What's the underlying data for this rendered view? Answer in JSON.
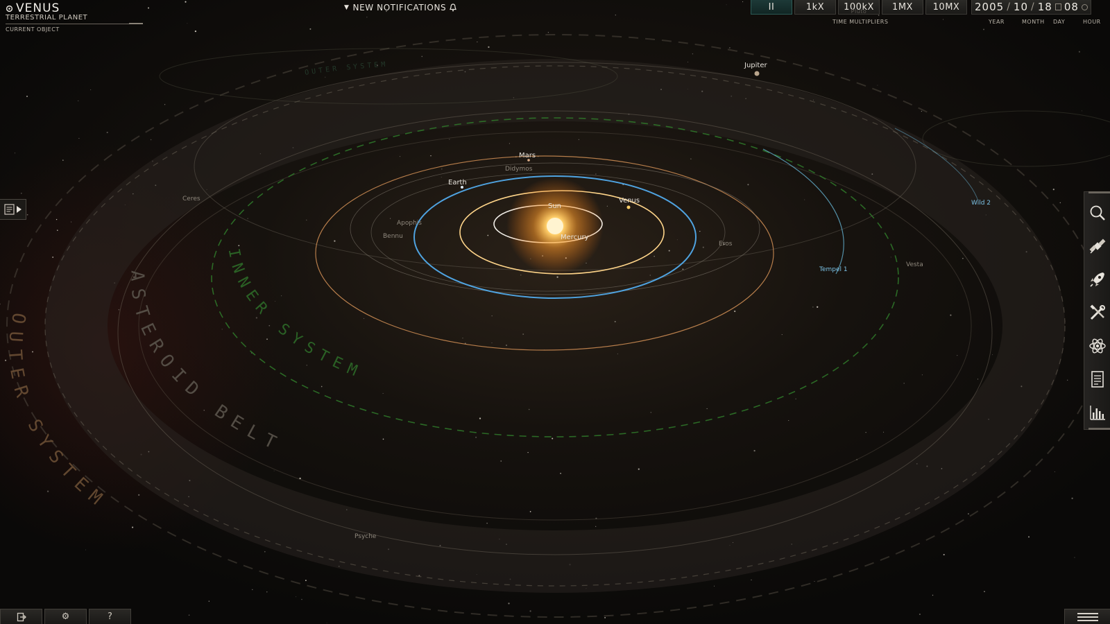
{
  "current_object": {
    "name": "VENUS",
    "type": "TERRESTRIAL PLANET",
    "caption": "CURRENT OBJECT",
    "icon": "planet-icon"
  },
  "notifications": {
    "label": "NEW NOTIFICATIONS",
    "icon": "bell-icon"
  },
  "time_controls": {
    "buttons": [
      {
        "label": "II",
        "active": true,
        "icon": "pause-icon"
      },
      {
        "label": "1kX",
        "active": false
      },
      {
        "label": "100kX",
        "active": false
      },
      {
        "label": "1MX",
        "active": false
      },
      {
        "label": "10MX",
        "active": false
      }
    ],
    "ghost_label": "Pluto",
    "caption": "TIME MULTIPLIERS"
  },
  "date": {
    "year": "2005",
    "month": "10",
    "day": "18",
    "hour": "08",
    "labels": {
      "year": "YEAR",
      "month": "MONTH",
      "day": "DAY",
      "hour": "HOUR"
    }
  },
  "map": {
    "region_labels": {
      "inner": "INNER SYSTEM",
      "belt": "ASTEROID BELT",
      "outer": "OUTER SYSTEM",
      "faint": "OUTER SYSTEM"
    },
    "bodies": {
      "sun": "Sun",
      "mercury": "Mercury",
      "venus": "Venus",
      "earth": "Earth",
      "mars": "Mars",
      "jupiter": "Jupiter",
      "didymos": "Didymos",
      "apophis": "Apophis",
      "bennu": "Bennu",
      "eros": "Eros",
      "ceres": "Ceres",
      "vesta": "Vesta",
      "psyche": "Psyche",
      "tempel1": "Tempel 1",
      "wild2": "Wild 2"
    },
    "colors": {
      "sun": "#ffb347",
      "venus_orbit": "#ffd58a",
      "earth_orbit": "#4fa3e0",
      "mars_orbit": "#c98a52",
      "inner_boundary": "#2f7a2a",
      "comet": "#6ec4e8",
      "comet_label": "#7cc3e6"
    }
  },
  "side_panel_toggle": {
    "icon": "panel-expand-icon"
  },
  "toolbar": [
    {
      "name": "search",
      "icon": "search-icon"
    },
    {
      "name": "satellite",
      "icon": "satellite-icon"
    },
    {
      "name": "rocket",
      "icon": "rocket-icon"
    },
    {
      "name": "tools",
      "icon": "tools-icon"
    },
    {
      "name": "atom",
      "icon": "atom-icon"
    },
    {
      "name": "document",
      "icon": "document-icon"
    },
    {
      "name": "stats",
      "icon": "bar-chart-icon"
    }
  ],
  "bottom_buttons": [
    {
      "name": "exit",
      "icon": "exit-icon"
    },
    {
      "name": "settings",
      "icon": "gear-icon",
      "glyph": "⚙"
    },
    {
      "name": "help",
      "icon": "help-icon",
      "glyph": "?"
    }
  ],
  "menu_button": {
    "icon": "hamburger-menu-icon"
  }
}
